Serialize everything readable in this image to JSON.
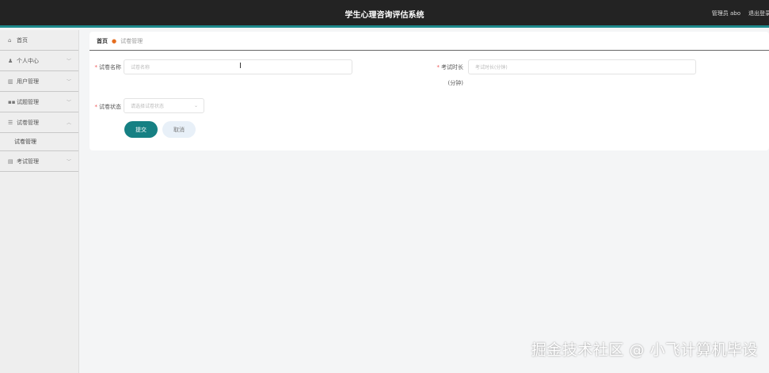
{
  "header": {
    "title": "学生心理咨询评估系统",
    "user": "管理员 abo",
    "logout": "退出登录"
  },
  "sidebar": {
    "items": [
      {
        "label": "首页",
        "icon": "home-icon",
        "chevron": ""
      },
      {
        "label": "个人中心",
        "icon": "user-icon",
        "chevron": "﹀"
      },
      {
        "label": "用户管理",
        "icon": "users-icon",
        "chevron": "﹀"
      },
      {
        "label": "试题管理",
        "icon": "grid-icon",
        "chevron": "﹀"
      },
      {
        "label": "试卷管理",
        "icon": "list-icon",
        "chevron": "︿"
      },
      {
        "label": "考试管理",
        "icon": "exam-icon",
        "chevron": "﹀"
      }
    ],
    "sub": {
      "label": "试卷管理"
    }
  },
  "breadcrumb": {
    "home": "首页",
    "current": "试卷管理"
  },
  "form": {
    "name_label": "试卷名称",
    "name_placeholder": "试卷名称",
    "duration_label": "考试时长",
    "duration_unit": "(分钟)",
    "duration_placeholder": "考试时长(分钟)",
    "status_label": "试卷状态",
    "status_placeholder": "请选择试卷状态",
    "submit": "提交",
    "cancel": "取消"
  },
  "watermark": "掘金技术社区 @ 小飞计算机毕设",
  "colors": {
    "header": "#232323",
    "accent": "#1e8a8c",
    "breadcrumb_dot": "#e56d1f"
  }
}
